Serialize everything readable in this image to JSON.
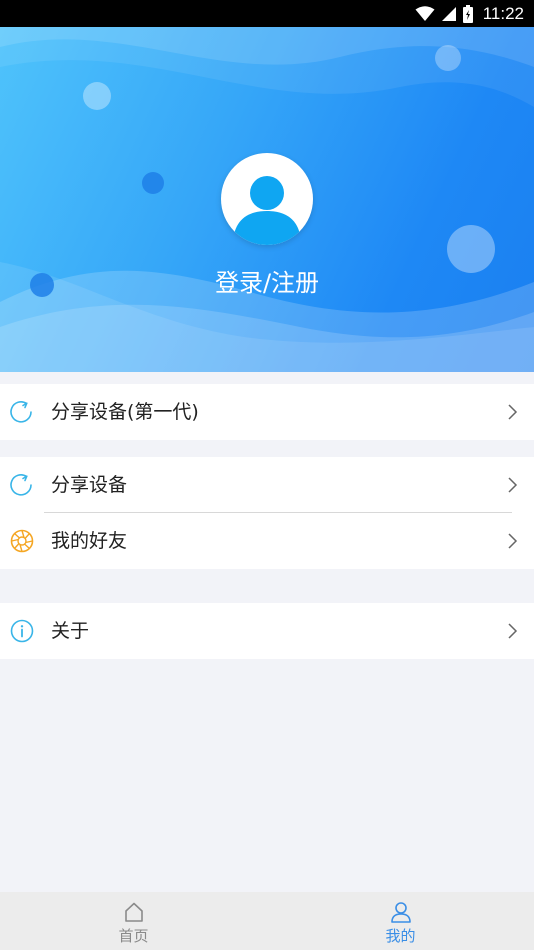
{
  "status_bar": {
    "time": "11:22"
  },
  "header": {
    "login_text": "登录/注册"
  },
  "menu": {
    "share_device_gen1": "分享设备(第一代)",
    "share_device": "分享设备",
    "my_friends": "我的好友",
    "about": "关于"
  },
  "tabbar": {
    "home_label": "首页",
    "mine_label": "我的",
    "active": "mine"
  },
  "colors": {
    "accent": "#3a8ee6",
    "header_start": "#4fc3fb",
    "header_end": "#1a7ff0",
    "share_icon": "#39b5e8",
    "friends_icon": "#f5a623"
  }
}
